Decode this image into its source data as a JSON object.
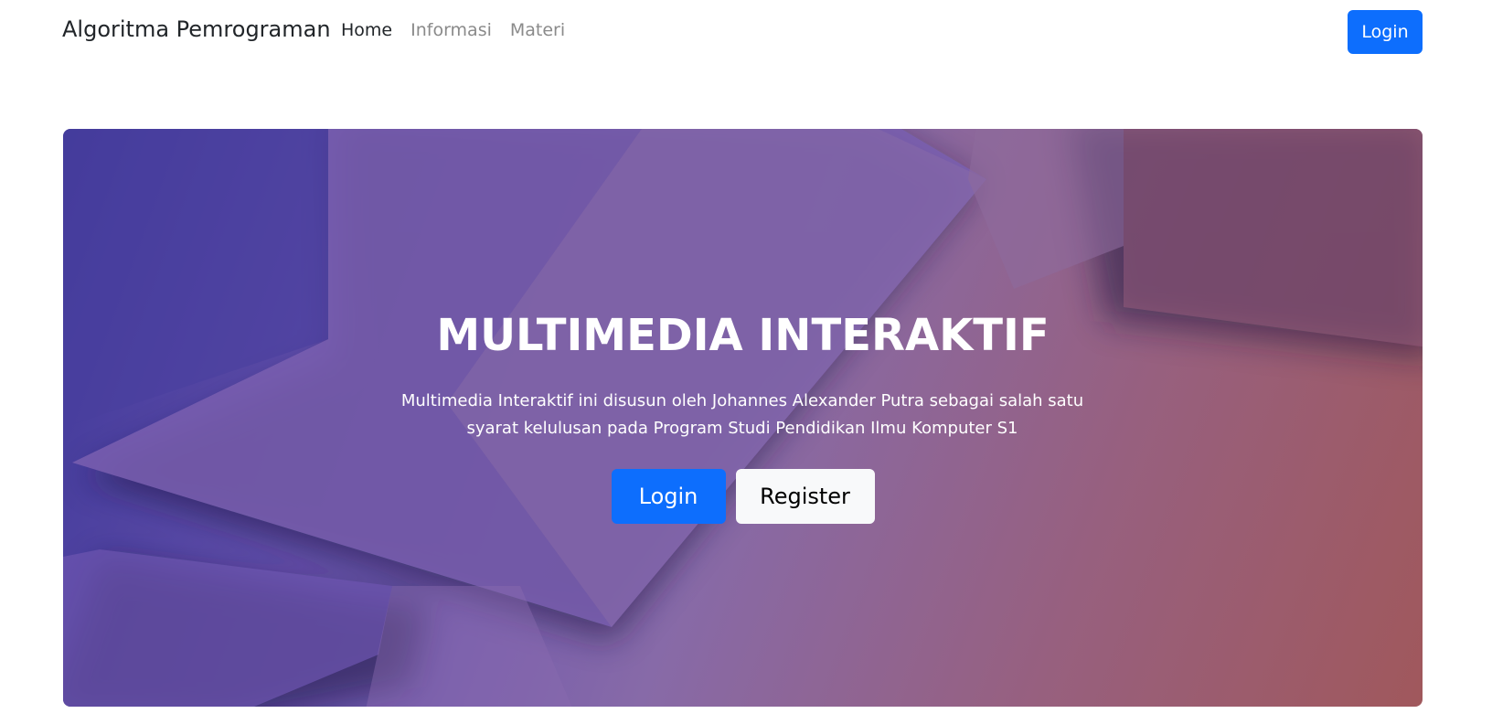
{
  "navbar": {
    "brand": "Algoritma Pemrograman",
    "links": [
      {
        "label": "Home",
        "active": true
      },
      {
        "label": "Informasi",
        "active": false
      },
      {
        "label": "Materi",
        "active": false
      }
    ],
    "login_label": "Login"
  },
  "hero": {
    "title": "MULTIMEDIA INTERAKTIF",
    "description": "Multimedia Interaktif ini disusun oleh Johannes Alexander Putra sebagai salah satu syarat kelulusan pada Program Studi Pendidikan Ilmu Komputer S1",
    "login_label": "Login",
    "register_label": "Register"
  },
  "colors": {
    "primary": "#0d6efd",
    "light": "#f8f9fa",
    "text_dark": "#212529",
    "text_muted": "#8a8a8a"
  }
}
